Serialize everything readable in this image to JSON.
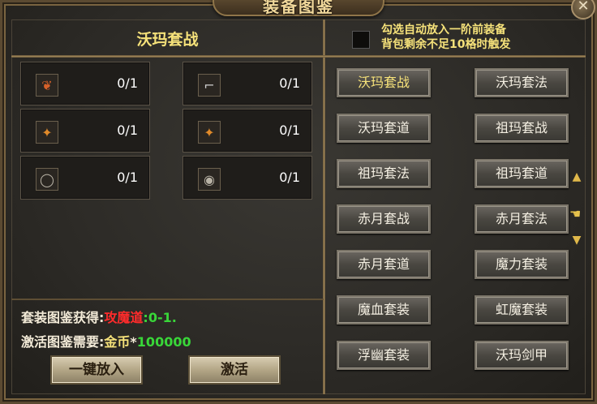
{
  "window": {
    "title": "装备图鉴",
    "close_icon": "close-icon"
  },
  "left": {
    "set_title": "沃玛套战",
    "slots": [
      {
        "icon": "necklace-icon",
        "glyph": "❦",
        "count": "0/1"
      },
      {
        "icon": "boots-icon",
        "glyph": "⌐",
        "count": "0/1"
      },
      {
        "icon": "bracelet-icon",
        "glyph": "✦",
        "count": "0/1"
      },
      {
        "icon": "bracelet-icon",
        "glyph": "✦",
        "count": "0/1"
      },
      {
        "icon": "ring-icon",
        "glyph": "◯",
        "count": "0/1"
      },
      {
        "icon": "ring-icon",
        "glyph": "◉",
        "count": "0/1"
      }
    ],
    "reward_label": "套装图鉴获得:",
    "reward_stat": "攻魔道",
    "reward_value": ":0-1.",
    "cost_label": "激活图鉴需要:",
    "cost_currency": "金币",
    "cost_star": "*",
    "cost_amount": "100000",
    "btn_put_in": "一键放入",
    "btn_activate": "激活"
  },
  "right": {
    "auto_note_line1": "勾选自动放入一阶前装备",
    "auto_note_line2": "背包剩余不足10格时触发",
    "suits": [
      "沃玛套战",
      "沃玛套法",
      "沃玛套道",
      "祖玛套战",
      "祖玛套法",
      "祖玛套道",
      "赤月套战",
      "赤月套法",
      "赤月套道",
      "魔力套装",
      "魔血套装",
      "虹魔套装",
      "浮幽套装",
      "沃玛剑甲"
    ],
    "active_index": 0
  },
  "colors": {
    "accent_yellow": "#f6e27a",
    "red": "#ff2b2b",
    "green": "#39d739"
  }
}
